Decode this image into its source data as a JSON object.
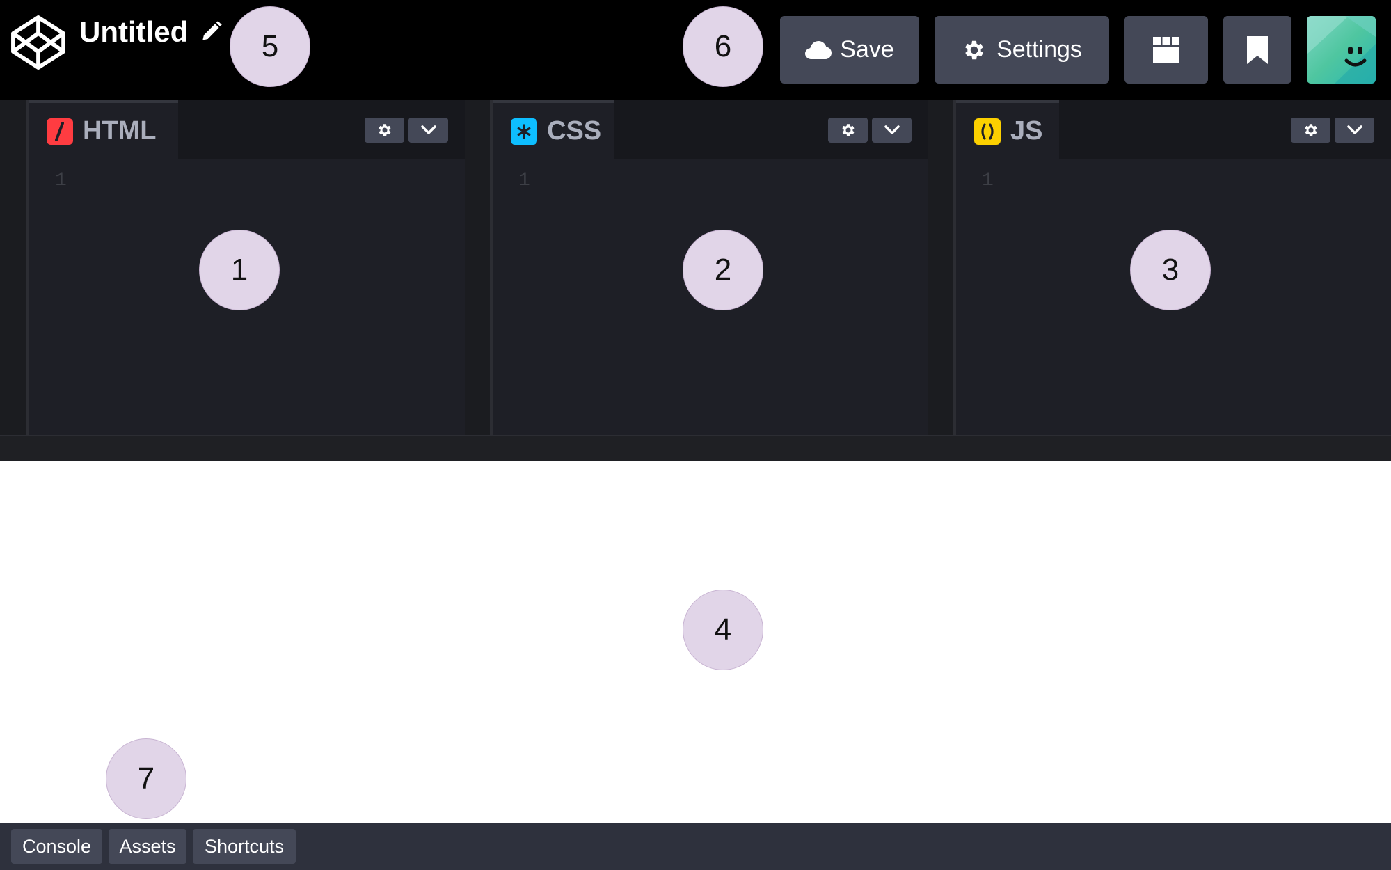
{
  "header": {
    "title": "Untitled",
    "logo_icon": "codepen-logo-icon",
    "edit_icon": "pencil-icon",
    "buttons": {
      "save_label": "Save",
      "save_icon": "cloud-icon",
      "settings_label": "Settings",
      "settings_icon": "gear-icon",
      "layout_icon": "layout-icon",
      "pin_icon": "bookmark-icon"
    },
    "avatar_icon": "smiley-avatar-icon"
  },
  "editors": [
    {
      "label": "HTML",
      "icon": "html-slash-icon",
      "icon_color": "#ff3c41",
      "line_number": "1"
    },
    {
      "label": "CSS",
      "icon": "css-asterisk-icon",
      "icon_color": "#0ebeff",
      "line_number": "1"
    },
    {
      "label": "JS",
      "icon": "js-parens-icon",
      "icon_color": "#fcd000",
      "line_number": "1"
    }
  ],
  "footer": {
    "console_label": "Console",
    "assets_label": "Assets",
    "shortcuts_label": "Shortcuts"
  },
  "markers": [
    "1",
    "2",
    "3",
    "4",
    "5",
    "6",
    "7"
  ],
  "colors": {
    "header_bg": "#000000",
    "button_bg": "#444857",
    "editor_bg": "#1e1f26",
    "footer_bg": "#2e313d",
    "marker_bg": "#e1d5e8"
  }
}
